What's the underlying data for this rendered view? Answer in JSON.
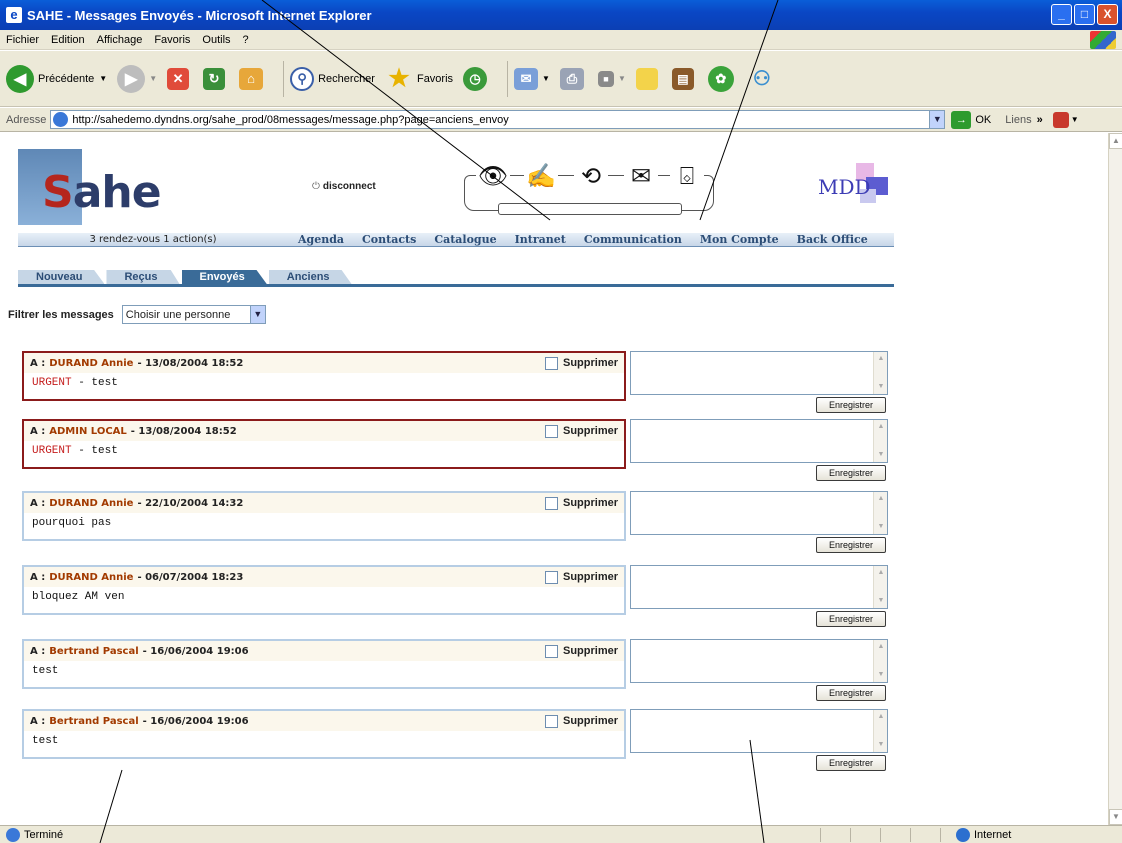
{
  "window": {
    "title": "SAHE - Messages Envoyés - Microsoft Internet Explorer",
    "min_glyph": "_",
    "max_glyph": "□",
    "close_glyph": "X"
  },
  "menu": [
    "Fichier",
    "Edition",
    "Affichage",
    "Favoris",
    "Outils",
    "?"
  ],
  "toolbar": {
    "back_label": "Précédente",
    "search_label": "Rechercher",
    "favorites_label": "Favoris"
  },
  "address": {
    "label": "Adresse",
    "url": "http://sahedemo.dyndns.org/sahe_prod/08messages/message.php?page=anciens_envoy",
    "go_label": "OK",
    "links_label": "Liens",
    "links_chevron": "»"
  },
  "site": {
    "logo_s": "S",
    "logo_rest": "ahe",
    "disconnect_label": "disconnect",
    "mdd_label": "MDD",
    "status_text": "3 rendez-vous  1 action(s)",
    "nav": [
      "Agenda",
      "Contacts",
      "Catalogue",
      "Intranet",
      "Communication",
      "Mon Compte",
      "Back Office"
    ],
    "tabs": [
      "Nouveau",
      "Reçus",
      "Envoyés",
      "Anciens"
    ],
    "active_tab": "Envoyés",
    "filter_label": "Filtrer les messages",
    "filter_value": "Choisir une personne"
  },
  "messages": [
    {
      "to_prefix": "A :",
      "to": "DURAND  Annie",
      "date": "- 13/08/2004 18:52",
      "urgent": "URGENT",
      "text": "- test",
      "delete_label": "Supprimer",
      "save_label": "Enregistrer"
    },
    {
      "to_prefix": "A :",
      "to": "ADMIN  LOCAL",
      "date": "- 13/08/2004 18:52",
      "urgent": "URGENT",
      "text": "- test",
      "delete_label": "Supprimer",
      "save_label": "Enregistrer"
    },
    {
      "to_prefix": "A :",
      "to": "DURAND  Annie",
      "date": "- 22/10/2004 14:32",
      "urgent": "",
      "text": "pourquoi pas",
      "delete_label": "Supprimer",
      "save_label": "Enregistrer"
    },
    {
      "to_prefix": "A :",
      "to": "DURAND  Annie",
      "date": "- 06/07/2004 18:23",
      "urgent": "",
      "text": "bloquez AM ven",
      "delete_label": "Supprimer",
      "save_label": "Enregistrer"
    },
    {
      "to_prefix": "A :",
      "to": "Bertrand  Pascal",
      "date": "- 16/06/2004 19:06",
      "urgent": "",
      "text": "test",
      "delete_label": "Supprimer",
      "save_label": "Enregistrer"
    },
    {
      "to_prefix": "A :",
      "to": "Bertrand  Pascal",
      "date": "- 16/06/2004 19:06",
      "urgent": "",
      "text": "test",
      "delete_label": "Supprimer",
      "save_label": "Enregistrer"
    }
  ],
  "statusbar": {
    "left_text": "Terminé",
    "zone_text": "Internet"
  },
  "colors": {
    "urgent_border": "#8b1b1b",
    "normal_border": "#b6cde4",
    "urgent_text": "#c51d1d",
    "recipient_text": "#a23a00",
    "nav_text": "#2c4d76",
    "tab_active": "#3a6b98"
  }
}
